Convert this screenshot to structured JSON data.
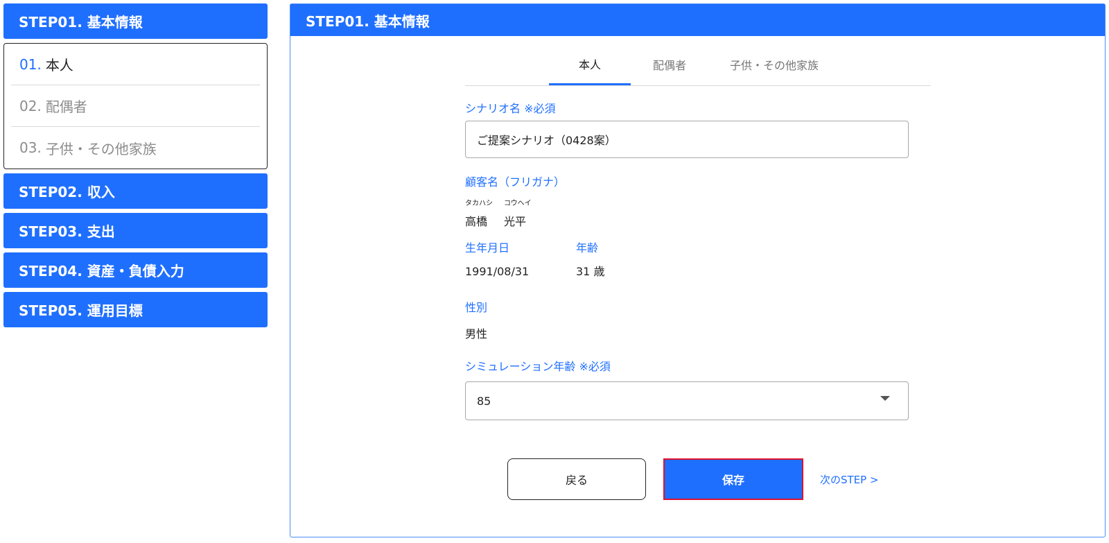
{
  "sidebar": {
    "step01": "STEP01. 基本情報",
    "sub_items": [
      {
        "num": "01.",
        "label": "本人"
      },
      {
        "num": "02.",
        "label": "配偶者"
      },
      {
        "num": "03.",
        "label": "子供・その他家族"
      }
    ],
    "step02": "STEP02. 収入",
    "step03": "STEP03. 支出",
    "step04": "STEP04. 資産・負債入力",
    "step05": "STEP05. 運用目標"
  },
  "main": {
    "header": "STEP01. 基本情報",
    "tabs": [
      "本人",
      "配偶者",
      "子供・その他家族"
    ],
    "scenario_label": "シナリオ名 ※必須",
    "scenario_value": "ご提案シナリオ（0428案）",
    "customer_label": "顧客名（フリガナ）",
    "furigana_last": "タカハシ",
    "furigana_first": "コウヘイ",
    "name_last": "高橋",
    "name_first": "光平",
    "birth_label": "生年月日",
    "birth_value": "1991/08/31",
    "age_label": "年齢",
    "age_value": "31 歳",
    "gender_label": "性別",
    "gender_value": "男性",
    "sim_age_label": "シミュレーション年齢 ※必須",
    "sim_age_value": "85",
    "back_button": "戻る",
    "save_button": "保存",
    "next_link": "次のSTEP >"
  },
  "colors": {
    "accent": "#1f6fff",
    "highlight_border": "#e0102a"
  }
}
